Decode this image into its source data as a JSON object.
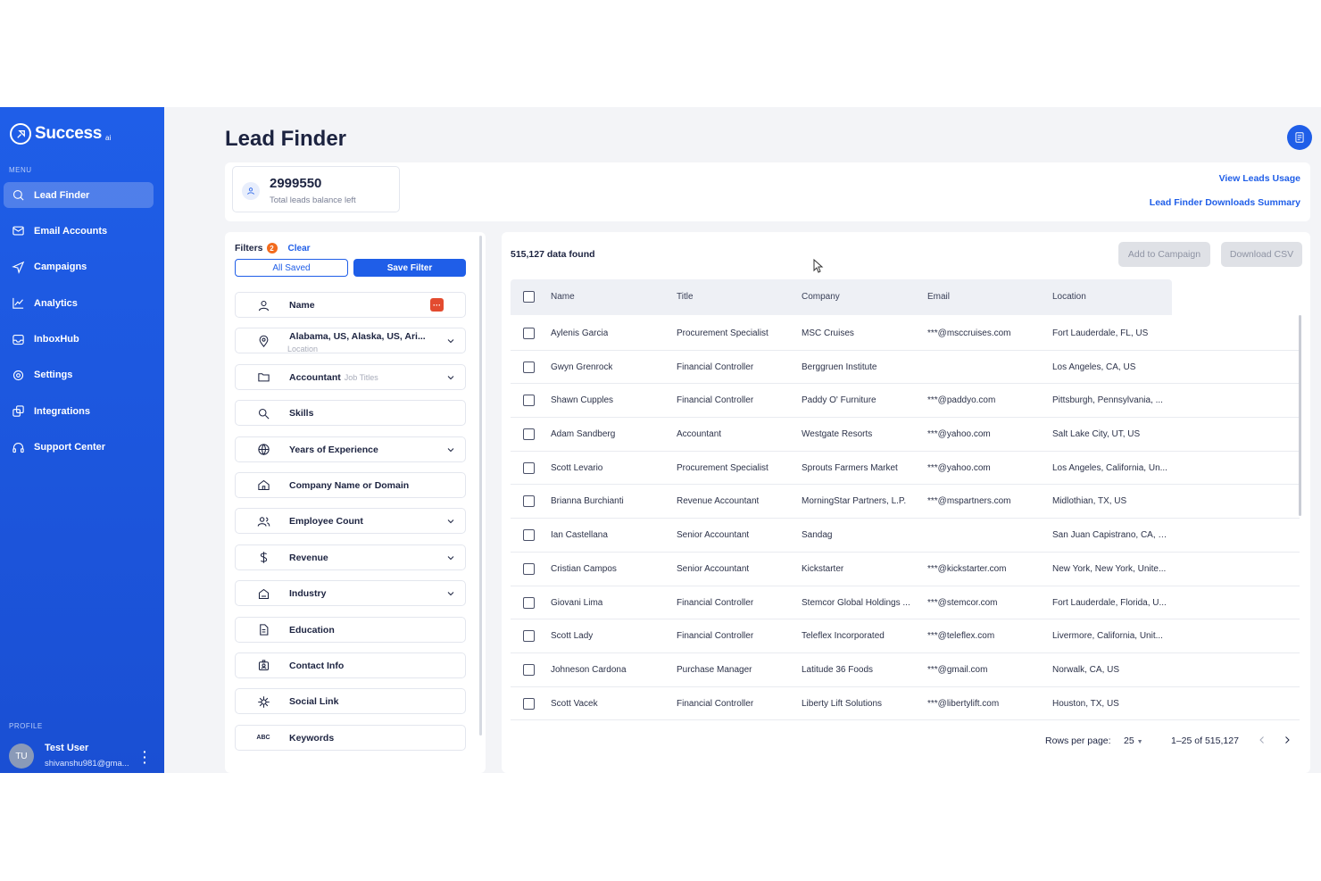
{
  "app": {
    "name": "Success",
    "name_suffix": "ai"
  },
  "sidebar": {
    "menu_label": "MENU",
    "items": [
      {
        "label": "Lead Finder",
        "icon": "search-icon",
        "active": true
      },
      {
        "label": "Email Accounts",
        "icon": "mail-icon"
      },
      {
        "label": "Campaigns",
        "icon": "send-icon"
      },
      {
        "label": "Analytics",
        "icon": "chart-line-icon"
      },
      {
        "label": "InboxHub",
        "icon": "inbox-icon"
      },
      {
        "label": "Settings",
        "icon": "gear-icon"
      },
      {
        "label": "Integrations",
        "icon": "integrations-icon"
      },
      {
        "label": "Support Center",
        "icon": "headset-icon"
      }
    ],
    "profile_label": "PROFILE",
    "user": {
      "initials": "TU",
      "name": "Test User",
      "email": "shivanshu981@gma..."
    }
  },
  "header": {
    "title": "Lead Finder"
  },
  "stats": {
    "balance": "2999550",
    "balance_label": "Total leads balance left",
    "view_usage": "View Leads Usage",
    "downloads_summary": "Lead Finder Downloads Summary"
  },
  "filters": {
    "title": "Filters",
    "count": "2",
    "clear": "Clear",
    "all_saved": "All Saved",
    "save_filter": "Save Filter",
    "items": [
      {
        "label": "Name"
      },
      {
        "label": "Alabama, US, Alaska, US, Ari...",
        "sub": "Location"
      },
      {
        "label": "Accountant",
        "sub": "Job Titles"
      },
      {
        "label": "Skills"
      },
      {
        "label": "Years of Experience"
      },
      {
        "label": "Company Name or Domain"
      },
      {
        "label": "Employee Count"
      },
      {
        "label": "Revenue"
      },
      {
        "label": "Industry"
      },
      {
        "label": "Education"
      },
      {
        "label": "Contact Info"
      },
      {
        "label": "Social Link"
      },
      {
        "label": "Keywords"
      }
    ]
  },
  "results": {
    "found": "515,127 data found",
    "add_to_campaign": "Add to Campaign",
    "download_csv": "Download CSV",
    "columns": [
      "Name",
      "Title",
      "Company",
      "Email",
      "Location"
    ],
    "rows": [
      [
        "Aylenis Garcia",
        "Procurement Specialist",
        "MSC Cruises",
        "***@msccruises.com",
        "Fort Lauderdale, FL, US"
      ],
      [
        "Gwyn Grenrock",
        "Financial Controller",
        "Berggruen Institute",
        "",
        "Los Angeles, CA, US"
      ],
      [
        "Shawn Cupples",
        "Financial Controller",
        "Paddy O' Furniture",
        "***@paddyo.com",
        "Pittsburgh, Pennsylvania, ..."
      ],
      [
        "Adam Sandberg",
        "Accountant",
        "Westgate Resorts",
        "***@yahoo.com",
        "Salt Lake City, UT, US"
      ],
      [
        "Scott Levario",
        "Procurement Specialist",
        "Sprouts Farmers Market",
        "***@yahoo.com",
        "Los Angeles, California, Un..."
      ],
      [
        "Brianna Burchianti",
        "Revenue Accountant",
        "MorningStar Partners, L.P.",
        "***@mspartners.com",
        "Midlothian, TX, US"
      ],
      [
        "Ian Castellana",
        "Senior Accountant",
        "Sandag",
        "",
        "San Juan Capistrano, CA, US"
      ],
      [
        "Cristian Campos",
        "Senior Accountant",
        "Kickstarter",
        "***@kickstarter.com",
        "New York, New York, Unite..."
      ],
      [
        "Giovani Lima",
        "Financial Controller",
        "Stemcor Global Holdings ...",
        "***@stemcor.com",
        "Fort Lauderdale, Florida, U..."
      ],
      [
        "Scott Lady",
        "Financial Controller",
        "Teleflex Incorporated",
        "***@teleflex.com",
        "Livermore, California, Unit..."
      ],
      [
        "Johneson Cardona",
        "Purchase Manager",
        "Latitude 36 Foods",
        "***@gmail.com",
        "Norwalk, CA, US"
      ],
      [
        "Scott Vacek",
        "Financial Controller",
        "Liberty Lift Solutions",
        "***@libertylift.com",
        "Houston, TX, US"
      ]
    ],
    "rows_per_page_label": "Rows per page:",
    "rows_per_page": "25",
    "range": "1–25 of 515,127"
  },
  "colors": {
    "accent": "#1f5ee8",
    "badge": "#f26b1d",
    "name_icon": "#e34b2f"
  }
}
